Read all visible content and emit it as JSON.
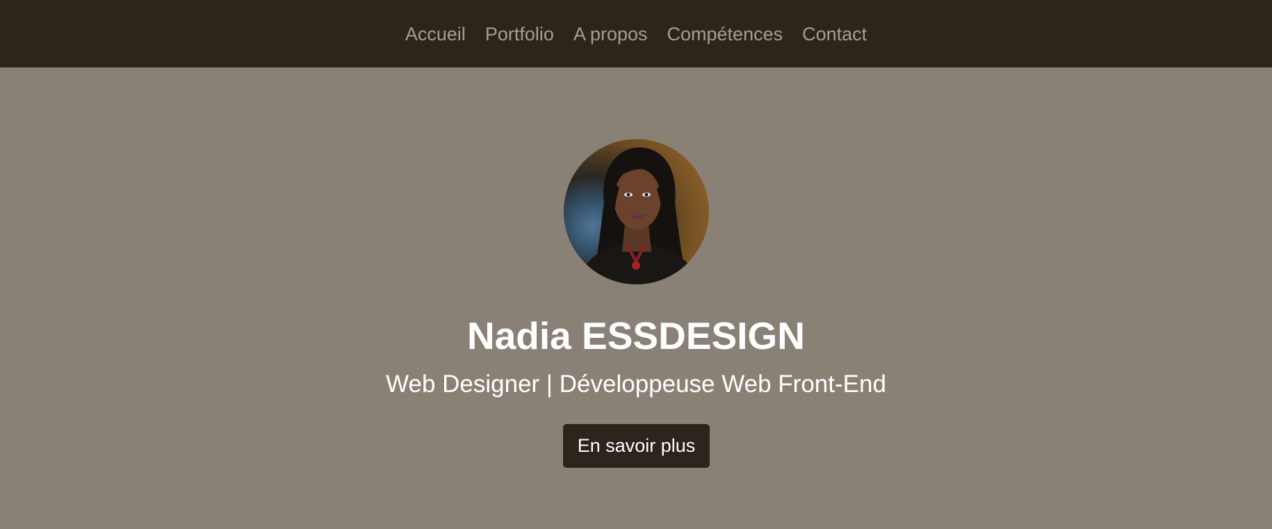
{
  "nav": {
    "items": [
      {
        "label": "Accueil"
      },
      {
        "label": "Portfolio"
      },
      {
        "label": "A propos"
      },
      {
        "label": "Compétences"
      },
      {
        "label": "Contact"
      }
    ]
  },
  "hero": {
    "name": "Nadia ESSDESIGN",
    "subtitle": "Web Designer | Développeuse Web Front-End",
    "cta_label": "En savoir plus"
  },
  "colors": {
    "navbar_bg": "#2d241c",
    "hero_bg": "#8a8176",
    "nav_text": "#a69d92",
    "heading_text": "#ffffff",
    "button_bg": "#2d241c"
  }
}
